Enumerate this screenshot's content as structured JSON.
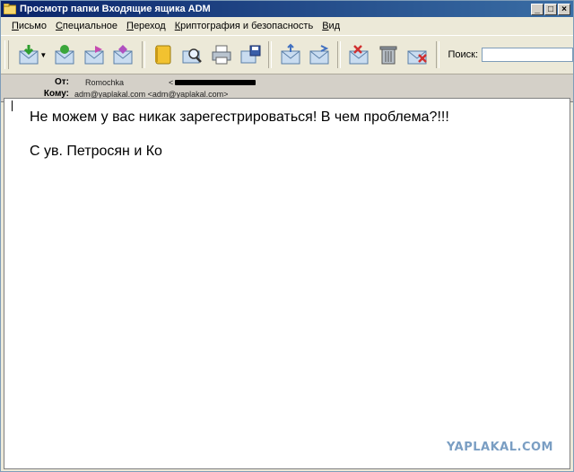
{
  "window": {
    "title": "Просмотр папки Входящие ящика ADM",
    "buttons": {
      "minimize": "_",
      "maximize": "□",
      "close": "×"
    }
  },
  "menu": [
    {
      "accel": "П",
      "rest": "исьмо"
    },
    {
      "accel": "С",
      "rest": "пециальное"
    },
    {
      "accel": "П",
      "rest": "ереход"
    },
    {
      "accel": "К",
      "rest": "риптография и безопасность"
    },
    {
      "accel": "В",
      "rest": "ид"
    }
  ],
  "toolbar": {
    "icons": [
      "get-mail-icon",
      "reply-icon",
      "forward-icon",
      "reply-all-icon",
      "address-book-icon",
      "find-icon",
      "print-icon",
      "save-icon",
      "move-icon",
      "copy-icon",
      "mark-delete-icon",
      "trash-icon",
      "purge-icon"
    ],
    "search_label": "Поиск:",
    "search_value": ""
  },
  "header": {
    "from_label": "От:",
    "from_name": "Romochka",
    "from_email_prefix": "<",
    "to_label": "Кому:",
    "to_value": "adm@yaplakal.com <adm@yaplakal.com>"
  },
  "message": {
    "line1": "Не можем у вас никак зарегестрироваться! В чем проблема?!!!",
    "line2": "С ув. Петросян и Ко"
  },
  "watermark": "YAPLAKAL.COM"
}
